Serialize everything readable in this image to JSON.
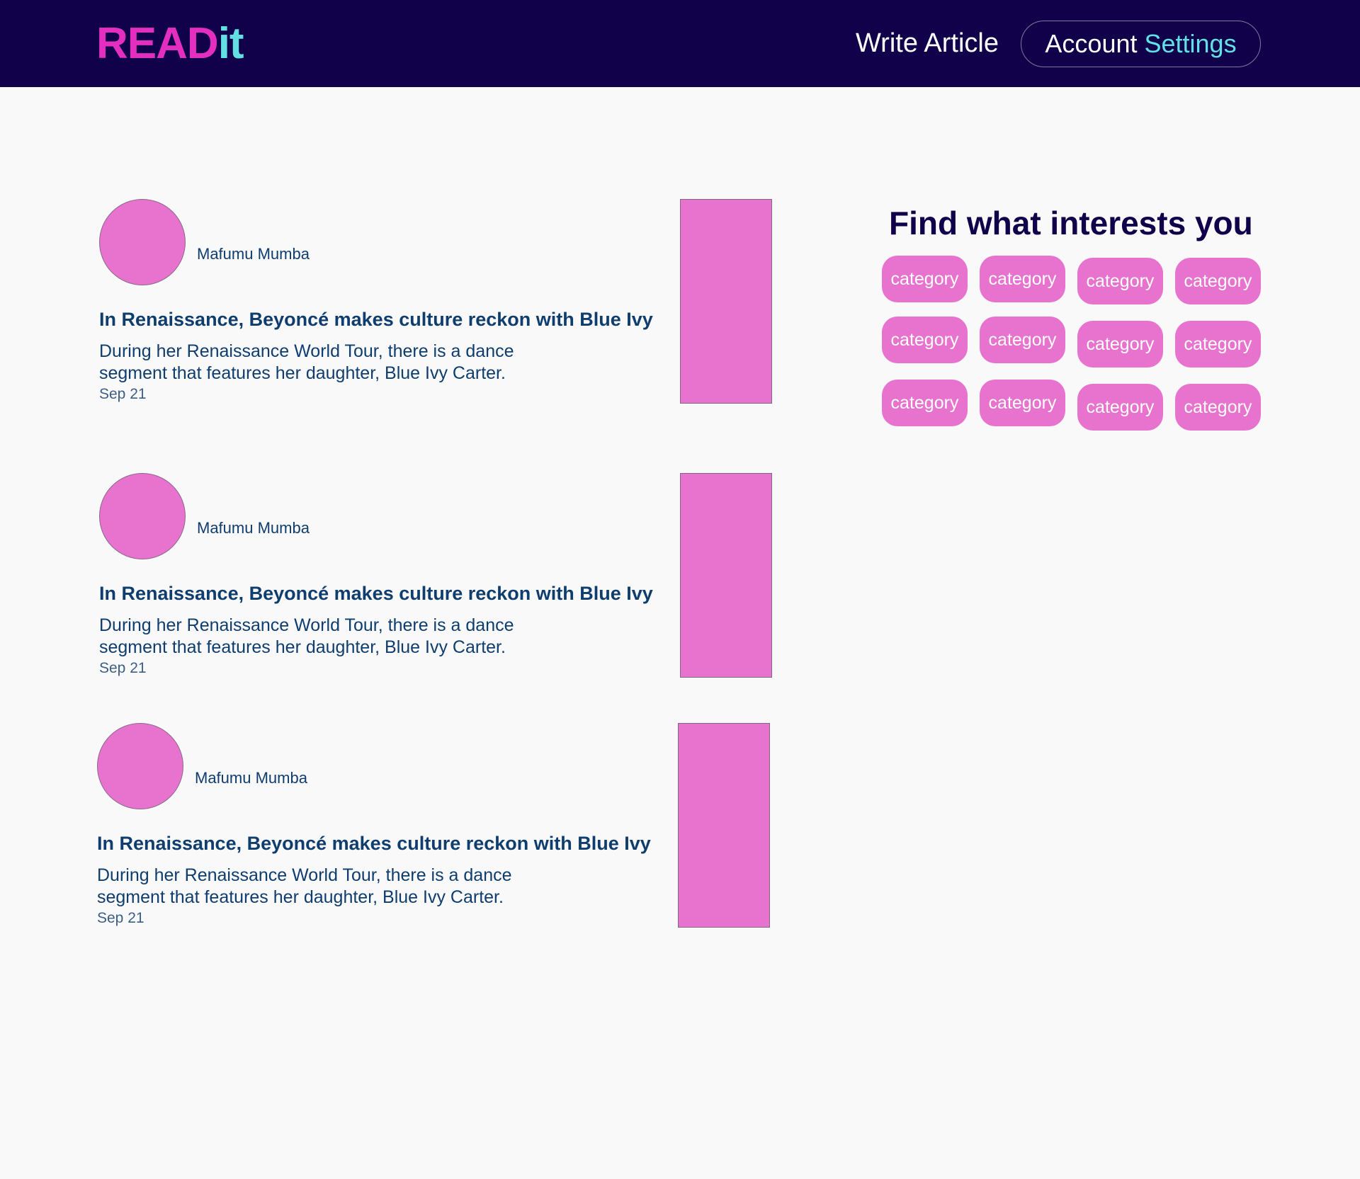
{
  "header": {
    "logo_part1": "READ",
    "logo_part2": "it",
    "write_article": "Write Article",
    "account_word1": "Account",
    "account_word2": "Settings"
  },
  "articles": [
    {
      "author": "Mafumu Mumba",
      "title": "In Renaissance, Beyoncé makes culture reckon with Blue Ivy",
      "excerpt": "During her Renaissance World Tour, there is a dance segment that features her daughter, Blue Ivy Carter.",
      "date": "Sep 21"
    },
    {
      "author": "Mafumu Mumba",
      "title": "In Renaissance, Beyoncé makes culture reckon with Blue Ivy",
      "excerpt": "During her Renaissance World Tour, there is a dance segment that features her daughter, Blue Ivy Carter.",
      "date": "Sep 21"
    },
    {
      "author": "Mafumu Mumba",
      "title": "In Renaissance, Beyoncé makes culture reckon with Blue Ivy",
      "excerpt": "During her Renaissance World Tour, there is a dance segment that features her daughter, Blue Ivy Carter.",
      "date": "Sep 21"
    }
  ],
  "interests": {
    "title": "Find what interests you",
    "categories": [
      "category",
      "category",
      "category",
      "category",
      "category",
      "category",
      "category",
      "category",
      "category",
      "category",
      "category",
      "category"
    ]
  },
  "colors": {
    "header_bg": "#11004a",
    "logo_pink": "#e42ec0",
    "logo_cyan": "#62e0e4",
    "accent_pink": "#e773cf",
    "text_blue": "#0f3d6e"
  }
}
